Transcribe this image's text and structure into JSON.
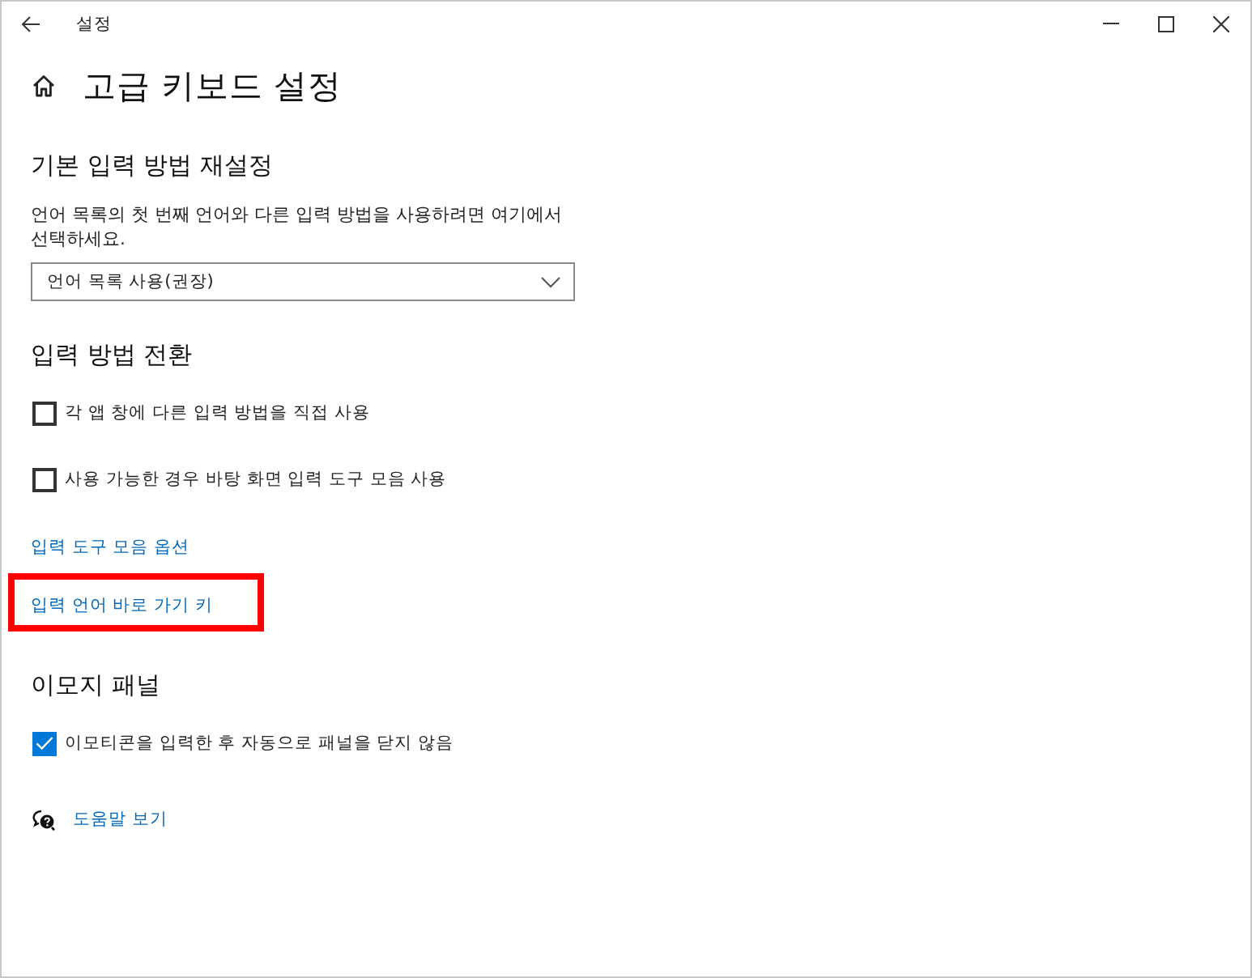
{
  "window": {
    "title": "설정"
  },
  "page": {
    "title": "고급 키보드 설정"
  },
  "sections": [
    {
      "heading": "기본 입력 방법 재설정",
      "items": [
        {
          "kind": "text",
          "text": "언어 목록의 첫 번째 언어와 다른 입력 방법을 사용하려면 여기에서 선택하세요."
        },
        {
          "kind": "dropdown",
          "value": "언어 목록 사용(권장)"
        }
      ]
    },
    {
      "heading": "입력 방법 전환",
      "items": [
        {
          "kind": "checkbox",
          "label": "각 앱 창에 다른 입력 방법을 직접 사용",
          "checked": false
        },
        {
          "kind": "checkbox",
          "label": "사용 가능한 경우 바탕 화면 입력 도구 모음 사용",
          "checked": false
        },
        {
          "kind": "link",
          "label": "입력 도구 모음 옵션",
          "highlighted": false
        },
        {
          "kind": "link",
          "label": "입력 언어 바로 가기 키",
          "highlighted": true
        }
      ]
    },
    {
      "heading": "이모지 패널",
      "items": [
        {
          "kind": "checkbox",
          "label": "이모티콘을 입력한 후 자동으로 패널을 닫지 않음",
          "checked": true
        }
      ]
    }
  ],
  "help_link": {
    "label": "도움말 보기"
  }
}
